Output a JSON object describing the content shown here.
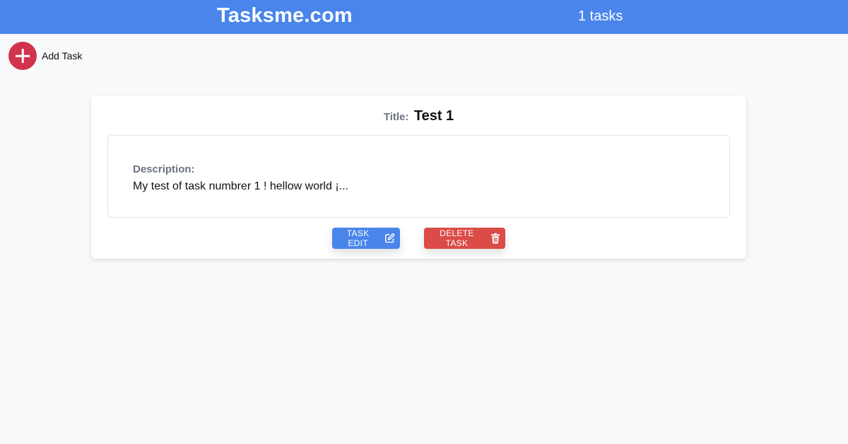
{
  "header": {
    "brand": "Tasksme.com",
    "task_count": "1 tasks",
    "color": "#4a85ec"
  },
  "add_task": {
    "label": "Add Task",
    "icon": "plus-circle-icon",
    "color": "#d1334c"
  },
  "task": {
    "title_label": "Title:",
    "title": "Test 1",
    "description_label": "Description:",
    "description": "My test of task numbrer 1 ! hellow world ¡..."
  },
  "actions": {
    "edit_label": "TASK EDIT",
    "edit_icon": "edit-icon",
    "delete_label": "DELETE TASK",
    "delete_icon": "trash-icon",
    "edit_color": "#4a85ec",
    "delete_color": "#db4b47"
  }
}
